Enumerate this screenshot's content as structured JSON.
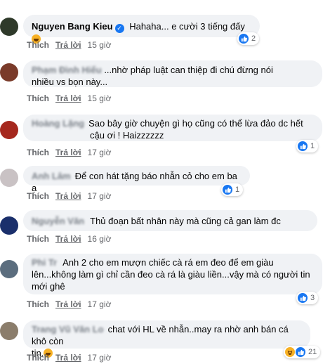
{
  "actions": {
    "like": "Thích",
    "reply": "Trả lời"
  },
  "comments": [
    {
      "name": "Nguyen Bang Kieu",
      "verified": true,
      "lines": [
        "Hahaha... e cười 3 tiếng đấy"
      ],
      "time": "15 giờ",
      "reactions": {
        "types": [
          "like"
        ],
        "count": "2"
      }
    },
    {
      "name": "Phạm Đình Hiếu",
      "lines": [
        "...nhờ pháp luật can thiệp đi chú đừng nói",
        "nhiều vs bọn này..."
      ],
      "time": "15 giờ"
    },
    {
      "name": "Hoàng Lặng",
      "lines": [
        "Sao bây giờ chuyện gì họ cũng có thể lừa đảo dc hết",
        "cậu ơi ! Haizzzzzz"
      ],
      "time": "17 giờ",
      "reactions": {
        "types": [
          "like"
        ],
        "count": "1"
      }
    },
    {
      "name": "Anh Lâm",
      "lines": [
        "Để con hát tặng báo nhẫn cỏ cho em ba ạ"
      ],
      "time": "17 giờ",
      "reactions": {
        "types": [
          "like"
        ],
        "count": "1"
      }
    },
    {
      "name": "Nguyễn Văn",
      "lines": [
        "Thủ đoạn bất nhân này mà cũng cả gan làm đc"
      ],
      "time": "16 giờ"
    },
    {
      "name": "Phi Tr",
      "lines": [
        "Anh 2 cho em mượn chiếc cà rá em đeo để em giàu",
        "lên...không làm gì chỉ cần đeo cà rá là giàu liền...vậy mà có người tin",
        "mới ghê"
      ],
      "time": "17 giờ",
      "reactions": {
        "types": [
          "like"
        ],
        "count": "3"
      }
    },
    {
      "name": "Trang Vũ Văn Lo",
      "lines": [
        "chat với HL về nhẫn..may ra nhờ anh bán cá khô còn",
        "tin."
      ],
      "time": "17 giờ",
      "reactions": {
        "types": [
          "haha",
          "like"
        ],
        "count": "21"
      }
    }
  ]
}
